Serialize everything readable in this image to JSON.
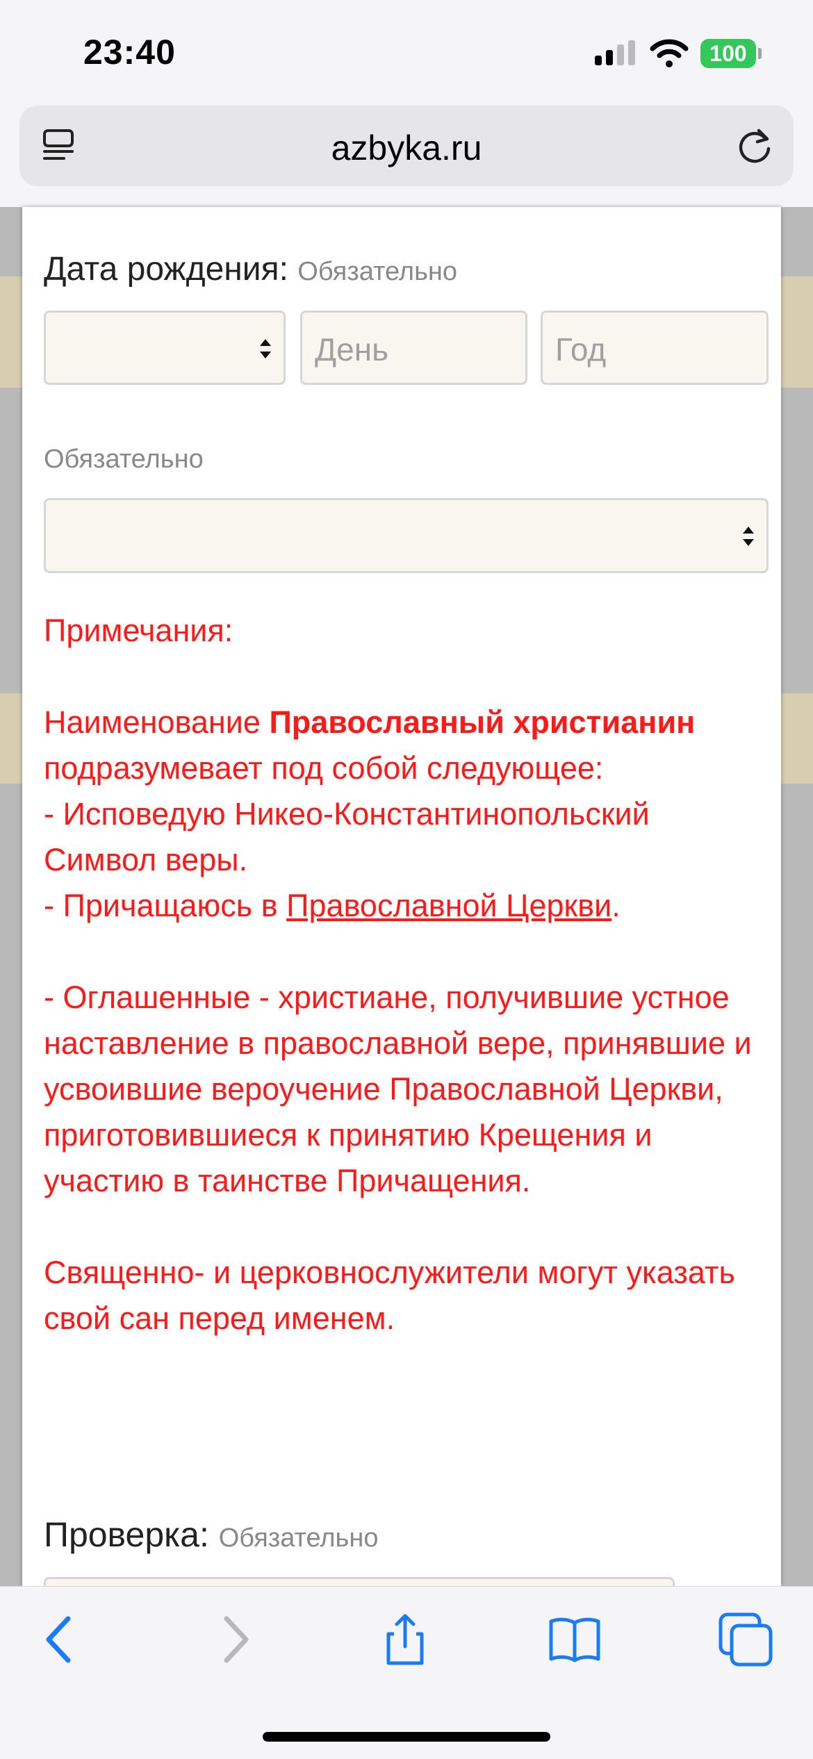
{
  "status_bar": {
    "time": "23:40",
    "battery": "100",
    "icons": [
      "signal-icon",
      "wifi-icon",
      "battery-icon"
    ]
  },
  "browser": {
    "url": "azbyka.ru",
    "icons": [
      "reader-icon",
      "reload-icon"
    ]
  },
  "form": {
    "birth_date": {
      "label": "Дата рождения:",
      "required": "Обязательно",
      "day_placeholder": "День",
      "year_placeholder": "Год"
    },
    "religion": {
      "required": "Обязательно"
    },
    "notes": {
      "title": "Примечания:",
      "p1_prefix": "Наименование ",
      "p1_bold": "Православный христианин",
      "p1_suffix": " подразумевает под собой следующее:",
      "p2": "- Исповедую Никео-Константинопольский Символ веры.",
      "p3_prefix": "- Причащаюсь в ",
      "p3_link": "Православной Церкви",
      "p3_suffix": ".",
      "p4": "- Оглашенные - христиане, получившие устное наставление в православной вере, принявшие и усвоившие вероучение Православной Церкви, приготовившиеся к принятию Крещения и участию в таинстве Причащения.",
      "p5": "Священно- и церковнослужители могут указать свой сан перед именем."
    },
    "check": {
      "label": "Проверка:",
      "required": "Обязательно"
    }
  },
  "toolbar": {
    "icons": [
      "back-icon",
      "forward-icon",
      "share-icon",
      "bookmarks-icon",
      "tabs-icon"
    ]
  },
  "colors": {
    "note_text": "#ff1a1a",
    "field_bg": "#f8f6ee",
    "battery": "#34c759",
    "accent": "#1a7cf5"
  }
}
